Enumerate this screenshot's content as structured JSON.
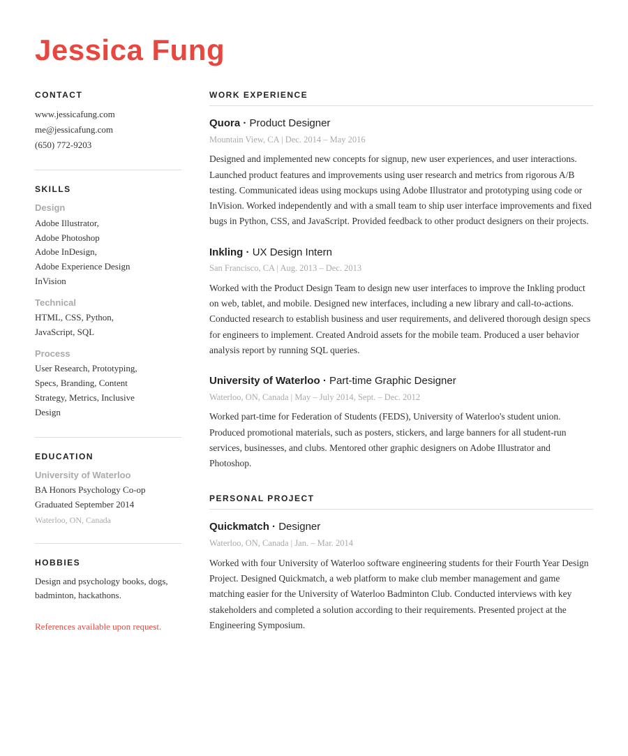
{
  "header": {
    "name": "Jessica Fung"
  },
  "sidebar": {
    "contact": {
      "title": "CONTACT",
      "items": [
        "www.jessicafung.com",
        "me@jessicafung.com",
        "(650) 772-9203"
      ]
    },
    "skills": {
      "title": "SKILLS",
      "categories": [
        {
          "name": "Design",
          "items": "Adobe Illustrator, Adobe Photoshop Adobe InDesign, Adobe Experience Design InVision"
        },
        {
          "name": "Technical",
          "items": "HTML, CSS, Python, JavaScript, SQL"
        },
        {
          "name": "Process",
          "items": "User Research, Prototyping, Specs, Branding, Content Strategy, Metrics, Inclusive Design"
        }
      ]
    },
    "education": {
      "title": "EDUCATION",
      "school": "University of Waterloo",
      "degree": "BA Honors Psychology Co-op",
      "graduated": "Graduated September 2014",
      "location": "Waterloo, ON, Canada"
    },
    "hobbies": {
      "title": "HOBBIES",
      "text": "Design and psychology books, dogs, badminton, hackathons."
    },
    "references": "References available upon request."
  },
  "content": {
    "work_experience": {
      "title": "WORK EXPERIENCE",
      "jobs": [
        {
          "company": "Quora",
          "role": "Product Designer",
          "location": "Mountain View, CA",
          "dates": "Dec. 2014 – May 2016",
          "description": "Designed and implemented new concepts for signup, new user experiences, and user interactions. Launched product features and improvements using user research and metrics from rigorous A/B testing. Communicated ideas using mockups using Adobe Illustrator and prototyping using code or InVision. Worked independently and with a small team to ship user interface improvements and fixed bugs in Python, CSS, and JavaScript. Provided feedback to other product designers on their projects."
        },
        {
          "company": "Inkling",
          "role": "UX Design Intern",
          "location": "San Francisco, CA",
          "dates": "Aug. 2013 – Dec. 2013",
          "description": "Worked with the Product Design Team to design new user interfaces to improve the Inkling product on web, tablet, and mobile. Designed new interfaces, including a new library and call-to-actions. Conducted research to establish business and user requirements, and delivered thorough design specs for engineers to implement. Created Android assets for the mobile team. Produced a user behavior analysis report by running SQL queries."
        },
        {
          "company": "University of Waterloo",
          "role": "Part-time Graphic Designer",
          "location": "Waterloo, ON, Canada",
          "dates": "May – July 2014, Sept. – Dec. 2012",
          "description": "Worked part-time for Federation of Students (FEDS), University of Waterloo's student union. Produced promotional materials, such as posters, stickers, and large banners for all student-run services, businesses, and clubs. Mentored other graphic designers on Adobe Illustrator and Photoshop."
        }
      ]
    },
    "personal_project": {
      "title": "PERSONAL PROJECT",
      "projects": [
        {
          "company": "Quickmatch",
          "role": "Designer",
          "location": "Waterloo, ON, Canada",
          "dates": "Jan. – Mar. 2014",
          "description": "Worked with four University of Waterloo software engineering students for their Fourth Year Design Project. Designed Quickmatch, a web platform to make club member management and game matching easier for the University of Waterloo Badminton Club. Conducted interviews with key stakeholders and completed a solution according to their requirements. Presented project at the Engineering Symposium."
        }
      ]
    }
  }
}
